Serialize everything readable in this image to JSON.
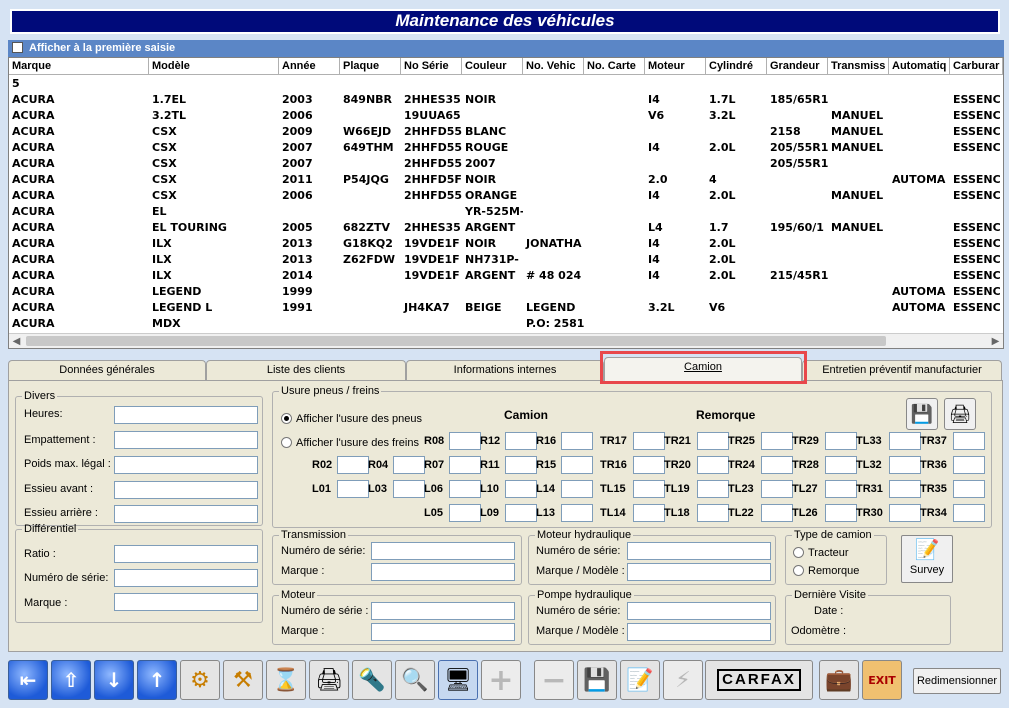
{
  "window": {
    "title": "Maintenance des véhicules"
  },
  "first_entry": {
    "label": "Afficher à la première saisie",
    "checked": false
  },
  "grid": {
    "columns": [
      "Marque",
      "Modèle",
      "Année",
      "Plaque",
      "No Série",
      "Couleur",
      "No. Vehic",
      "No. Carte",
      "Moteur",
      "Cylindré",
      "Grandeur",
      "Transmiss",
      "Automatiq",
      "Carburar"
    ],
    "rows": [
      [
        "5",
        "",
        "",
        "",
        "",
        "",
        "",
        "",
        "",
        "",
        "",
        "",
        "",
        ""
      ],
      [
        "ACURA",
        "1.7EL",
        "2003",
        "849NBR",
        "2HHES35",
        "NOIR",
        "",
        "",
        "I4",
        "1.7L",
        "185/65R1",
        "",
        "",
        "ESSENC"
      ],
      [
        "ACURA",
        "3.2TL",
        "2006",
        "",
        "19UUA65",
        "",
        "",
        "",
        "V6",
        "3.2L",
        "",
        "MANUEL",
        "",
        "ESSENC"
      ],
      [
        "ACURA",
        "CSX",
        "2009",
        "W66EJD",
        "2HHFD55",
        "BLANC",
        "",
        "",
        "",
        "",
        "2158",
        "MANUEL",
        "",
        "ESSENC"
      ],
      [
        "ACURA",
        "CSX",
        "2007",
        "649THM",
        "2HHFD55",
        "ROUGE",
        "",
        "",
        "I4",
        "2.0L",
        "205/55R1",
        "MANUEL",
        "",
        "ESSENC"
      ],
      [
        "ACURA",
        "CSX",
        "2007",
        "",
        "2HHFD55",
        "2007",
        "",
        "",
        "",
        "",
        "205/55R1",
        "",
        "",
        ""
      ],
      [
        "ACURA",
        "CSX",
        "2011",
        "P54JQG",
        "2HHFD5F",
        "NOIR",
        "",
        "",
        "2.0",
        "4",
        "",
        "",
        "AUTOMA",
        "ESSENC"
      ],
      [
        "ACURA",
        "CSX",
        "2006",
        "",
        "2HHFD55",
        "ORANGE",
        "",
        "",
        "I4",
        "2.0L",
        "",
        "MANUEL",
        "",
        "ESSENC"
      ],
      [
        "ACURA",
        "EL",
        "",
        "",
        "",
        "YR-525M-",
        "",
        "",
        "",
        "",
        "",
        "",
        "",
        ""
      ],
      [
        "ACURA",
        "EL TOURING",
        "2005",
        "682ZTV",
        "2HHES35",
        "ARGENT",
        "",
        "",
        "L4",
        "1.7",
        "195/60/1",
        "MANUEL",
        "",
        "ESSENC"
      ],
      [
        "ACURA",
        "ILX",
        "2013",
        "G18KQ2",
        "19VDE1F",
        "NOIR",
        "JONATHA",
        "",
        "I4",
        "2.0L",
        "",
        "",
        "",
        "ESSENC"
      ],
      [
        "ACURA",
        "ILX",
        "2013",
        "Z62FDW",
        "19VDE1F",
        "NH731P-",
        "",
        "",
        "I4",
        "2.0L",
        "",
        "",
        "",
        "ESSENC"
      ],
      [
        "ACURA",
        "ILX",
        "2014",
        "",
        "19VDE1F",
        "ARGENT",
        "# 48 024",
        "",
        "I4",
        "2.0L",
        "215/45R1",
        "",
        "",
        "ESSENC"
      ],
      [
        "ACURA",
        "LEGEND",
        "1999",
        "",
        "",
        "",
        "",
        "",
        "",
        "",
        "",
        "",
        "AUTOMA",
        "ESSENC"
      ],
      [
        "ACURA",
        "LEGEND L",
        "1991",
        "",
        "JH4KA7",
        "BEIGE",
        "LEGEND",
        "",
        "3.2L",
        "V6",
        "",
        "",
        "AUTOMA",
        "ESSENC"
      ],
      [
        "ACURA",
        "MDX",
        "",
        "",
        "",
        "",
        "P.O: 2581",
        "",
        "",
        "",
        "",
        "",
        "",
        ""
      ]
    ]
  },
  "tabs": [
    {
      "label": "Données générales",
      "active": false
    },
    {
      "label": "Liste des clients",
      "active": false
    },
    {
      "label": "Informations internes",
      "active": false
    },
    {
      "label": "Camion",
      "active": true
    },
    {
      "label": "Entretien préventif manufacturier",
      "active": false
    }
  ],
  "divers": {
    "title": "Divers",
    "fields": [
      "Heures:",
      "Empattement  :",
      "Poids max. légal :",
      "Essieu avant :",
      "Essieu arrière :"
    ]
  },
  "differentiel": {
    "title": "Différentiel",
    "fields": [
      "Ratio :",
      "Numéro de série:",
      "Marque :"
    ]
  },
  "usure": {
    "title": "Usure pneus / freins",
    "radio_pneus": "Afficher l'usure des pneus",
    "radio_freins": "Afficher l'usure des freins",
    "selected": "pneus",
    "camion_label": "Camion",
    "remorque_label": "Remorque",
    "camion_rows": [
      [
        "R08",
        "R12",
        "R16"
      ],
      [
        "R02",
        "R04",
        "R07",
        "R11",
        "R15"
      ],
      [
        "L01",
        "L03",
        "L06",
        "L10",
        "L14"
      ],
      [
        "L05",
        "L09",
        "L13"
      ]
    ],
    "remorque_rows": [
      [
        "TR17",
        "TR21",
        "TR25",
        "TR29",
        "TL33",
        "TR37"
      ],
      [
        "TR16",
        "TR20",
        "TR24",
        "TR28",
        "TL32",
        "TR36"
      ],
      [
        "TL15",
        "TL19",
        "TL23",
        "TL27",
        "TR31",
        "TR35"
      ],
      [
        "TL14",
        "TL18",
        "TL22",
        "TL26",
        "TR30",
        "TR34"
      ]
    ]
  },
  "transmission": {
    "title": "Transmission",
    "serial_label": "Numéro de série:",
    "brand_label": "Marque :"
  },
  "moteur": {
    "title": "Moteur",
    "serial_label": "Numéro de série :",
    "brand_label": "Marque :"
  },
  "moteur_hydraulique": {
    "title": "Moteur hydraulique",
    "serial_label": "Numéro de série:",
    "brand_label": "Marque / Modèle :"
  },
  "pompe_hydraulique": {
    "title": "Pompe hydraulique",
    "serial_label": "Numéro de série:",
    "brand_label": "Marque / Modèle :"
  },
  "type_camion": {
    "title": "Type de camion",
    "option1": "Tracteur",
    "option2": "Remorque"
  },
  "survey": {
    "label": "Survey"
  },
  "derniere_visite": {
    "title": "Dernière Visite",
    "date_label": "Date :",
    "odometer_label": "Odomètre :"
  },
  "toolbar": {
    "carfax_label": "CARFAX",
    "resize_label": "Redimensionner",
    "accent_blue": "#1e5bd8",
    "title_bg": "#000a7a",
    "highlight": "#e8474b"
  }
}
